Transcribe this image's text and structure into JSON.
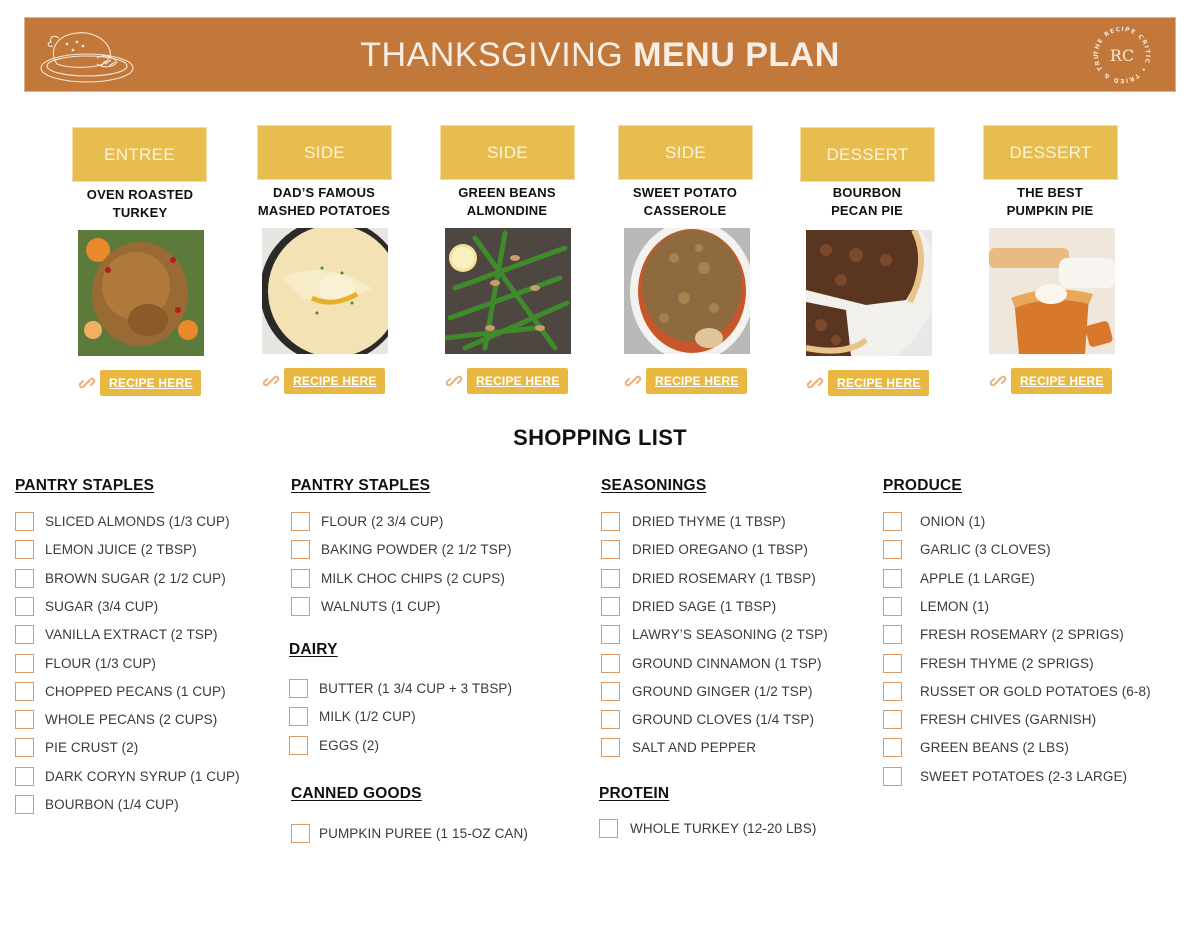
{
  "header": {
    "title_light": "THANKSGIVING",
    "title_bold": "MENU PLAN",
    "logo_icon": "roast-turkey-platter-icon",
    "brand_badge": {
      "monogram": "RC",
      "ring_text": "THE RECIPE CRITIC • TRIED & TRUE •"
    },
    "brand_color": "#c2783b"
  },
  "menu": {
    "accent_color": "#e8bd4f",
    "items": [
      {
        "category": "ENTREE",
        "name_line1": "OVEN ROASTED",
        "name_line2": "TURKEY",
        "photo": "roast-turkey-photo",
        "link_label": "RECIPE HERE"
      },
      {
        "category": "SIDE",
        "name_line1": "DAD’S FAMOUS",
        "name_line2": "MASHED POTATOES",
        "photo": "mashed-potatoes-photo",
        "link_label": "RECIPE HERE"
      },
      {
        "category": "SIDE",
        "name_line1": "GREEN BEANS",
        "name_line2": "ALMONDINE",
        "photo": "green-beans-photo",
        "link_label": "RECIPE HERE"
      },
      {
        "category": "SIDE",
        "name_line1": "SWEET POTATO",
        "name_line2": "CASSEROLE",
        "photo": "sweet-potato-casserole-photo",
        "link_label": "RECIPE HERE"
      },
      {
        "category": "DESSERT",
        "name_line1": "BOURBON",
        "name_line2": "PECAN PIE",
        "photo": "pecan-pie-photo",
        "link_label": "RECIPE HERE"
      },
      {
        "category": "DESSERT",
        "name_line1": "THE BEST",
        "name_line2": "PUMPKIN PIE",
        "photo": "pumpkin-pie-photo",
        "link_label": "RECIPE HERE"
      }
    ]
  },
  "shopping_list": {
    "title": "SHOPPING LIST",
    "checkbox_color": "#d89a69",
    "sections": [
      {
        "heading": "PANTRY STAPLES",
        "items": [
          {
            "label": "SLICED ALMONDS (1/3 CUP)",
            "checked": false
          },
          {
            "label": "LEMON JUICE (2 TBSP)",
            "checked": false
          },
          {
            "label": "BROWN SUGAR (2 1/2 CUP)",
            "checked": false
          },
          {
            "label": "SUGAR (3/4 CUP)",
            "checked": false
          },
          {
            "label": "VANILLA EXTRACT (2 TSP)",
            "checked": false
          },
          {
            "label": "FLOUR (1/3 CUP)",
            "checked": false
          },
          {
            "label": "CHOPPED PECANS (1 CUP)",
            "checked": false
          },
          {
            "label": "WHOLE PECANS (2 CUPS)",
            "checked": false
          },
          {
            "label": "PIE CRUST (2)",
            "checked": false
          },
          {
            "label": "DARK CORYN SYRUP (1 CUP)",
            "checked": false
          },
          {
            "label": "BOURBON (1/4 CUP)",
            "checked": false
          }
        ]
      },
      {
        "heading": "PANTRY STAPLES",
        "items": [
          {
            "label": "FLOUR (2 3/4 CUP)",
            "checked": false
          },
          {
            "label": "BAKING POWDER (2 1/2 TSP)",
            "checked": false
          },
          {
            "label": "MILK CHOC CHIPS (2 CUPS)",
            "checked": false
          },
          {
            "label": "WALNUTS (1 CUP)",
            "checked": false
          }
        ]
      },
      {
        "heading": "DAIRY",
        "items": [
          {
            "label": "BUTTER (1 3/4 CUP + 3 TBSP)",
            "checked": false
          },
          {
            "label": "MILK (1/2 CUP)",
            "checked": false
          },
          {
            "label": "EGGS (2)",
            "checked": false
          }
        ]
      },
      {
        "heading": "CANNED GOODS",
        "items": [
          {
            "label": "PUMPKIN PUREE (1 15-OZ CAN)",
            "checked": false
          }
        ]
      },
      {
        "heading": "SEASONINGS",
        "items": [
          {
            "label": "DRIED THYME (1 TBSP)",
            "checked": false
          },
          {
            "label": "DRIED OREGANO (1 TBSP)",
            "checked": false
          },
          {
            "label": "DRIED ROSEMARY (1 TBSP)",
            "checked": false
          },
          {
            "label": "DRIED SAGE (1 TBSP)",
            "checked": false
          },
          {
            "label": "LAWRY’S SEASONING (2 TSP)",
            "checked": false
          },
          {
            "label": "GROUND CINNAMON (1 TSP)",
            "checked": false
          },
          {
            "label": "GROUND GINGER (1/2 TSP)",
            "checked": false
          },
          {
            "label": "GROUND CLOVES (1/4 TSP)",
            "checked": false
          },
          {
            "label": "SALT AND PEPPER",
            "checked": false
          }
        ]
      },
      {
        "heading": "PROTEIN",
        "items": [
          {
            "label": "WHOLE TURKEY (12-20 LBS)",
            "checked": false
          }
        ]
      },
      {
        "heading": "PRODUCE",
        "items": [
          {
            "label": "ONION (1)",
            "checked": false
          },
          {
            "label": "GARLIC (3 CLOVES)",
            "checked": false
          },
          {
            "label": "APPLE (1 LARGE)",
            "checked": false
          },
          {
            "label": "LEMON (1)",
            "checked": false
          },
          {
            "label": "FRESH ROSEMARY (2 SPRIGS)",
            "checked": false
          },
          {
            "label": "FRESH THYME (2 SPRIGS)",
            "checked": false
          },
          {
            "label": "RUSSET OR GOLD POTATOES (6-8)",
            "checked": false
          },
          {
            "label": "FRESH CHIVES (GARNISH)",
            "checked": false
          },
          {
            "label": "GREEN BEANS (2 LBS)",
            "checked": false
          },
          {
            "label": "SWEET POTATOES (2-3 LARGE)",
            "checked": false
          }
        ]
      }
    ]
  }
}
